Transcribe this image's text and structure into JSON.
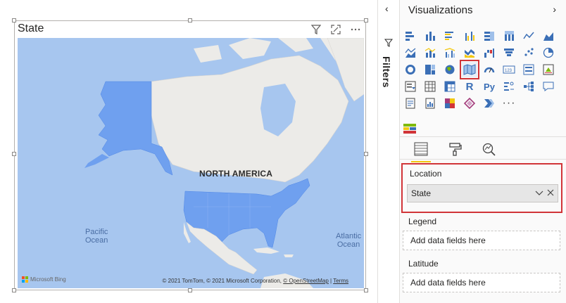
{
  "visual": {
    "title": "State",
    "map": {
      "continent_label": "NORTH AMERICA",
      "ocean_left": "Pacific\nOcean",
      "ocean_right": "Atlantic\nOcean",
      "bing_label": "Microsoft Bing",
      "attribution_text": "© 2021 TomTom, © 2021 Microsoft Corporation,",
      "osm_link": "© OpenStreetMap",
      "terms_link": "Terms",
      "highlight_color": "#6fa0ef",
      "land_color": "#ecebe8",
      "water_color": "#a7c6ef"
    }
  },
  "filters": {
    "label": "Filters"
  },
  "visualizations": {
    "title": "Visualizations",
    "selected_icon": "filled-map-icon",
    "fields_section": {
      "location": {
        "label": "Location",
        "field": "State"
      },
      "legend": {
        "label": "Legend",
        "placeholder": "Add data fields here"
      },
      "latitude": {
        "label": "Latitude",
        "placeholder": "Add data fields here"
      }
    }
  }
}
